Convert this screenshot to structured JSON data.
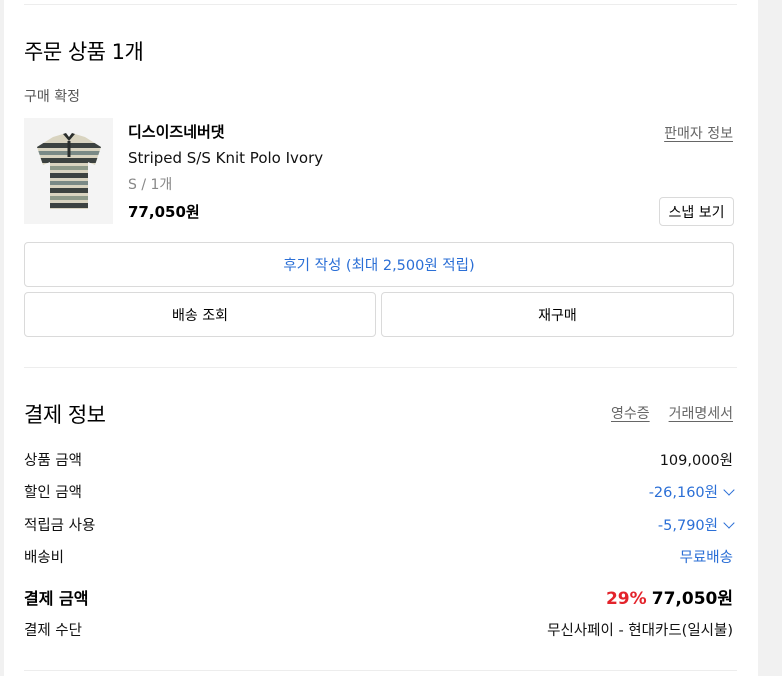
{
  "order": {
    "title": "주문 상품 1개",
    "status": "구매 확정",
    "item": {
      "brand": "디스이즈네버댓",
      "name": "Striped S/S Knit Polo Ivory",
      "option": "S / 1개",
      "price": "77,050원",
      "seller_info_label": "판매자 정보",
      "snap_label": "스냅 보기",
      "image_icon": "striped-polo-shirt-image"
    },
    "review_button": "후기 작성 (최대 2,500원 적립)",
    "delivery_button": "배송 조회",
    "reorder_button": "재구매"
  },
  "payment": {
    "title": "결제 정보",
    "receipt_link": "영수증",
    "statement_link": "거래명세서",
    "rows": [
      {
        "label": "상품 금액",
        "value": "109,000원"
      },
      {
        "label": "할인 금액",
        "value": "-26,160원"
      },
      {
        "label": "적립금 사용",
        "value": "-5,790원"
      },
      {
        "label": "배송비",
        "value": "무료배송"
      }
    ],
    "total": {
      "label": "결제 금액",
      "percent": "29%",
      "value": "77,050원"
    },
    "method": {
      "label": "결제 수단",
      "value": "무신사페이 - 현대카드(일시불)"
    }
  },
  "colors": {
    "accent_blue": "#2b6fd6",
    "discount_red": "#e3232b"
  }
}
